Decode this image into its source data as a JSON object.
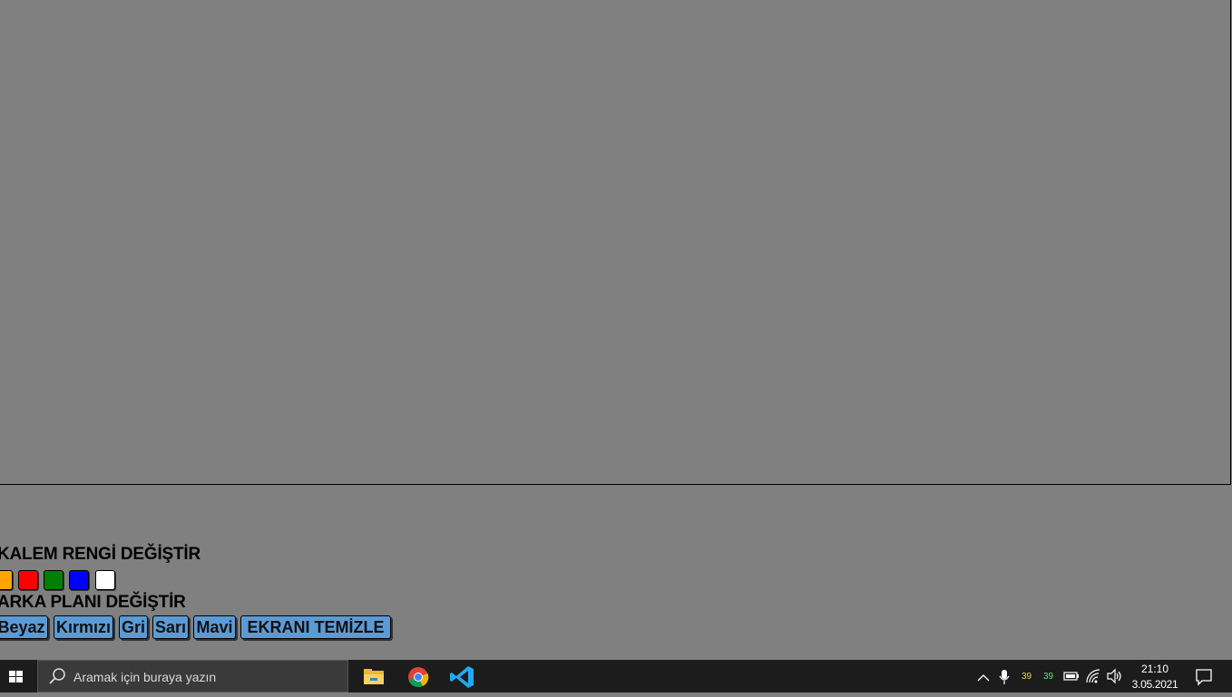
{
  "pen": {
    "label": "KALEM RENGİ DEĞİŞTİR",
    "swatches": [
      {
        "name": "orange",
        "color": "#ffa500"
      },
      {
        "name": "red",
        "color": "#ff0000"
      },
      {
        "name": "green",
        "color": "#008000"
      },
      {
        "name": "blue",
        "color": "#0000ff"
      },
      {
        "name": "white",
        "color": "#ffffff"
      }
    ]
  },
  "background": {
    "label": "ARKA PLANI DEĞİŞTİR",
    "buttons": [
      "Beyaz",
      "Kırmızı",
      "Gri",
      "Sarı",
      "Mavi"
    ],
    "clear_label": "EKRANI TEMİZLE"
  },
  "taskbar": {
    "search_placeholder": "Aramak için buraya yazın",
    "apps": [
      "file-explorer-icon",
      "chrome-icon",
      "vscode-icon"
    ],
    "tray": {
      "temp1": "39",
      "temp2": "39",
      "time": "21:10",
      "date": "3.05.2021"
    }
  }
}
